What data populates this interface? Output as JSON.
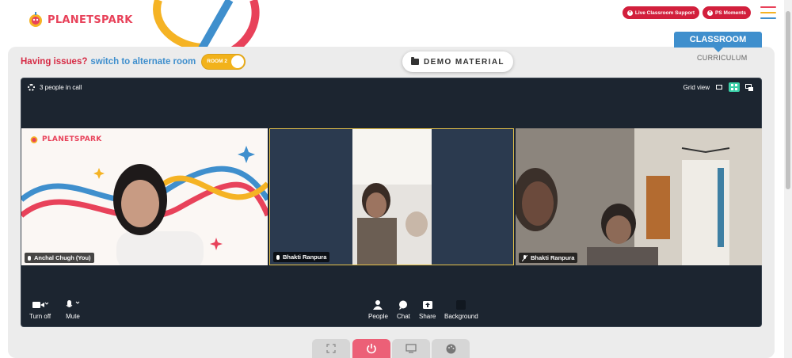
{
  "brand": {
    "logo_planet": "PLANET",
    "logo_spark": "SPARK"
  },
  "header": {
    "live_support_label": "Live Classroom Support",
    "ps_moments_label": "PS Moments",
    "classroom_tab": "CLASSROOM",
    "curriculum_tab": "CURRICULUM"
  },
  "issues": {
    "text": "Having issues?",
    "link": "switch to alternate room",
    "room_label": "ROOM 2"
  },
  "demo_material_label": "DEMO MATERIAL",
  "call": {
    "people_count": "3 people in call",
    "grid_view_label": "Grid view",
    "tiles": [
      {
        "name": "Anchal Chugh (You)",
        "mic": "on"
      },
      {
        "name": "Bhakti Ranpura",
        "mic": "on"
      },
      {
        "name": "Bhakti Ranpura",
        "mic": "off"
      }
    ],
    "controls": {
      "camera": "Turn off",
      "mute": "Mute",
      "people": "People",
      "chat": "Chat",
      "share": "Share",
      "background": "Background"
    }
  },
  "colors": {
    "brand_red": "#d21f3c",
    "accent_blue": "#3f8fcd",
    "toggle_yellow": "#f2b21b",
    "active_speaker": "#e7c34b"
  }
}
